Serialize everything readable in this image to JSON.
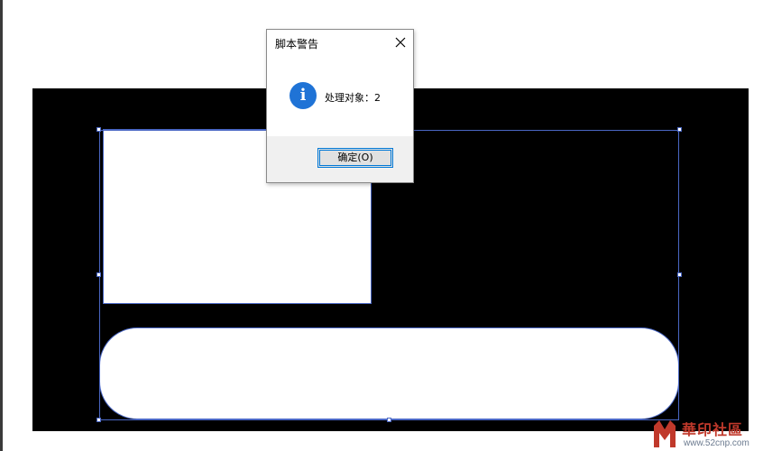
{
  "dialog": {
    "title": "脚本警告",
    "message": "处理对象：2",
    "ok_button": "确定(O)"
  },
  "watermark": {
    "name": "華印社區",
    "url": "www.52cnp.com"
  },
  "colors": {
    "artboard": "#000000",
    "selection": "#4a67c4",
    "info_icon": "#1f73d6",
    "button_focus": "#0078d7",
    "watermark_red": "#c0392b"
  }
}
